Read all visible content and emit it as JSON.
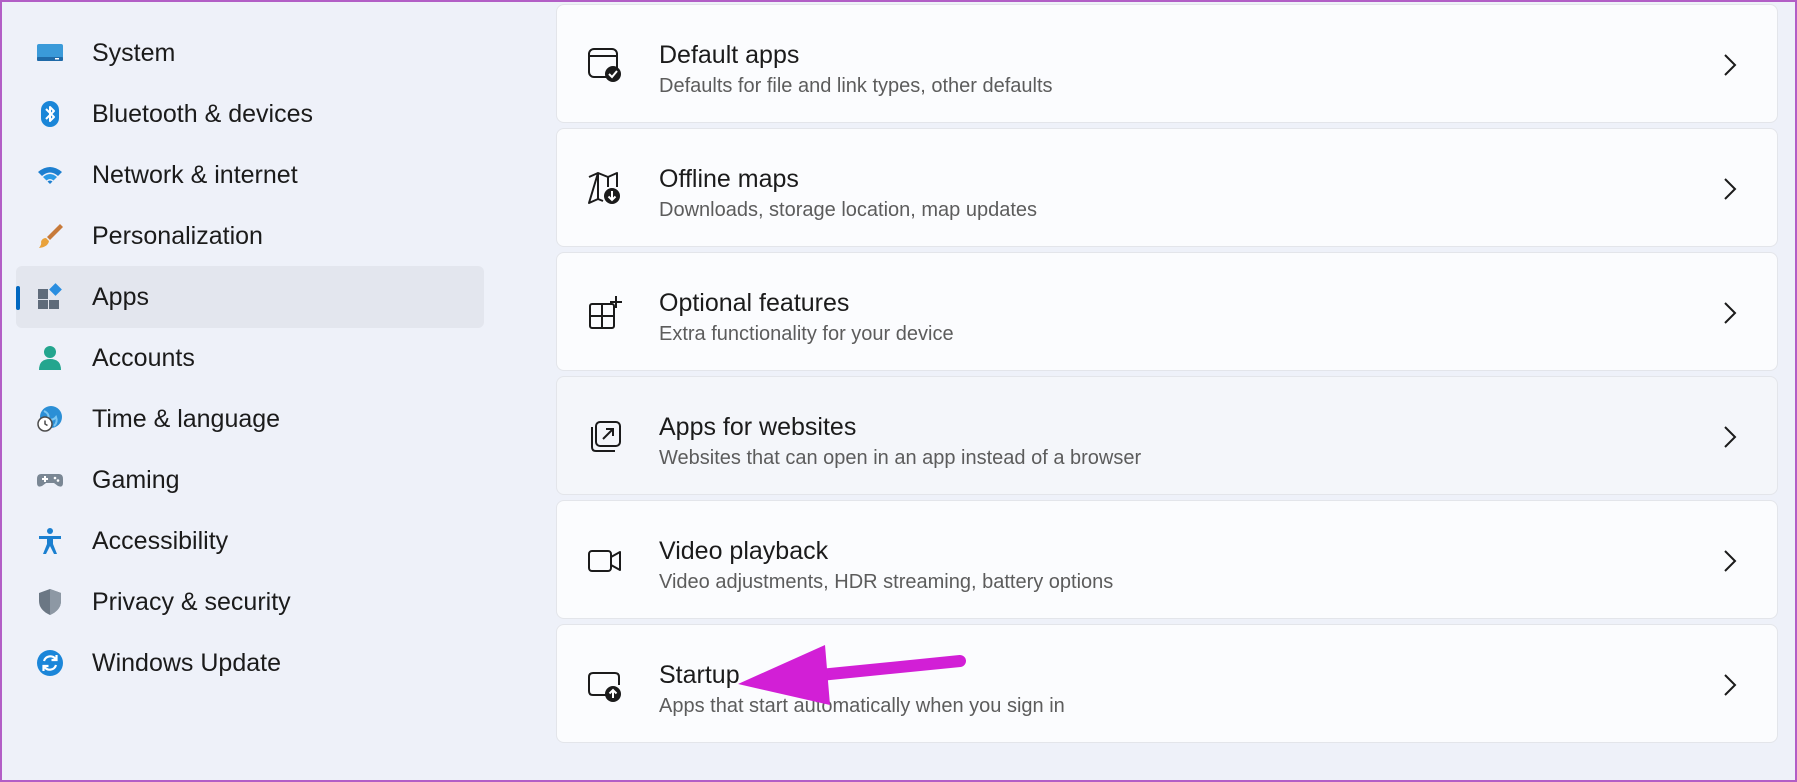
{
  "sidebar": {
    "items": [
      {
        "label": "System",
        "icon": "monitor-icon"
      },
      {
        "label": "Bluetooth & devices",
        "icon": "bluetooth-icon"
      },
      {
        "label": "Network & internet",
        "icon": "wifi-icon"
      },
      {
        "label": "Personalization",
        "icon": "brush-icon"
      },
      {
        "label": "Apps",
        "icon": "apps-icon",
        "selected": true
      },
      {
        "label": "Accounts",
        "icon": "account-icon"
      },
      {
        "label": "Time & language",
        "icon": "globe-clock-icon"
      },
      {
        "label": "Gaming",
        "icon": "gamepad-icon"
      },
      {
        "label": "Accessibility",
        "icon": "accessibility-icon"
      },
      {
        "label": "Privacy & security",
        "icon": "shield-icon"
      },
      {
        "label": "Windows Update",
        "icon": "update-icon"
      }
    ]
  },
  "main": {
    "cards": [
      {
        "title": "Default apps",
        "subtitle": "Defaults for file and link types, other defaults",
        "icon": "default-apps-icon"
      },
      {
        "title": "Offline maps",
        "subtitle": "Downloads, storage location, map updates",
        "icon": "offline-maps-icon"
      },
      {
        "title": "Optional features",
        "subtitle": "Extra functionality for your device",
        "icon": "optional-features-icon"
      },
      {
        "title": "Apps for websites",
        "subtitle": "Websites that can open in an app instead of a browser",
        "icon": "apps-for-websites-icon"
      },
      {
        "title": "Video playback",
        "subtitle": "Video adjustments, HDR streaming, battery options",
        "icon": "video-icon"
      },
      {
        "title": "Startup",
        "subtitle": "Apps that start automatically when you sign in",
        "icon": "startup-icon"
      }
    ]
  },
  "colors": {
    "accent": "#0067c0",
    "annotation_arrow": "#d21fd6",
    "frame_border": "#b25ec6"
  }
}
